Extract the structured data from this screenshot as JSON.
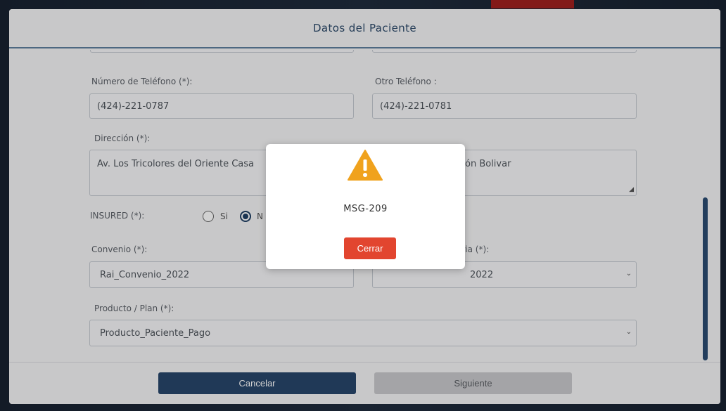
{
  "modal": {
    "title": "Datos del Paciente",
    "fields": {
      "phone": {
        "label": "Número de Teléfono (*):",
        "value": "(424)-221-0787"
      },
      "other_phone": {
        "label": "Otro Teléfono :",
        "value": "(424)-221-0781"
      },
      "address": {
        "label": "Dirección (*):",
        "value_left": "Av. Los Tricolores del Oriente Casa",
        "value_right": "ón Bolivar"
      },
      "insured": {
        "label": "INSURED (*):",
        "option_yes": "Si",
        "option_no_partial": "N",
        "selected": "No"
      },
      "agreement": {
        "label": "Convenio (*):",
        "value": "Rai_Convenio_2022"
      },
      "insurer_right": {
        "label_partial": "aria (*):",
        "value_partial": "2022"
      },
      "product": {
        "label": "Producto / Plan (*):",
        "value": "Producto_Paciente_Pago"
      }
    },
    "footer": {
      "cancel_label": "Cancelar",
      "next_label": "Siguiente"
    }
  },
  "alert": {
    "icon": "warning-icon",
    "message": "MSG-209",
    "close_label": "Cerrar"
  },
  "colors": {
    "primary": "#28466b",
    "danger": "#e2452f",
    "warning": "#f0a21d",
    "scroll_thumb": "#2b4c72"
  }
}
